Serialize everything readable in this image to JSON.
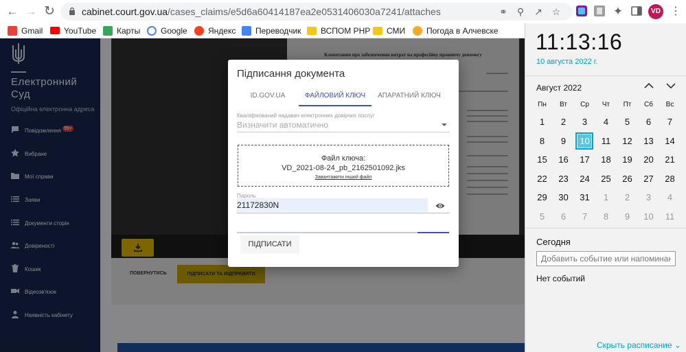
{
  "browser": {
    "url_host": "cabinet.court.gov.ua",
    "url_path": "/cases_claims/e5d6a60414187ea2e0531406030a7241/attaches",
    "profile_initials": "VD",
    "bookmarks": [
      {
        "label": "Gmail",
        "icon": "gmail-icon",
        "color": "#ea4335"
      },
      {
        "label": "YouTube",
        "icon": "youtube-icon",
        "color": "#ff0000"
      },
      {
        "label": "Карты",
        "icon": "maps-icon",
        "color": "#34a853"
      },
      {
        "label": "Google",
        "icon": "google-icon",
        "color": "#4285f4"
      },
      {
        "label": "Яндекс",
        "icon": "yandex-icon",
        "color": "#fc3f1d"
      },
      {
        "label": "Переводчик",
        "icon": "translate-icon",
        "color": "#4285f4"
      },
      {
        "label": "ВСПОМ РНР",
        "icon": "folder-icon",
        "color": "#f5c518"
      },
      {
        "label": "СМИ",
        "icon": "folder-icon",
        "color": "#f5c518"
      },
      {
        "label": "Погода в Алчевске",
        "icon": "weather-icon",
        "color": "#f9a825"
      }
    ]
  },
  "site": {
    "brand_line1": "Електронний",
    "brand_line2": "Суд",
    "brand_sub": "Офіційна електронна адреса",
    "menu": [
      {
        "label": "Повідомлення",
        "badge": "99+"
      },
      {
        "label": "Вибране"
      },
      {
        "label": "Мої справи"
      },
      {
        "label": "Заяви"
      },
      {
        "label": "Документи сторін"
      },
      {
        "label": "Довіреності"
      },
      {
        "label": "Кошик"
      },
      {
        "label": "Відеозв'язок"
      },
      {
        "label": "Наявність кабінету"
      }
    ],
    "doc_title": "Клопотання про забезпечення витрат на професійну правничу допомогу",
    "back_label": "ПОВЕРНУТИСЬ",
    "submit_send_label": "ПІДПИСАТИ ТА ВІДПРАВИТИ"
  },
  "dialog": {
    "title": "Підписання документа",
    "tabs": [
      "ID.GOV.UA",
      "ФАЙЛОВИЙ КЛЮЧ",
      "АПАРАТНИЙ КЛЮЧ"
    ],
    "active_tab": 1,
    "provider_label": "Кваліфікований надавач електронних довірчих послуг",
    "provider_value": "Визначити автоматично",
    "key_file_label": "Файл ключа:",
    "key_file_name": "VD_2021-08-24_pb_2162501092.jks",
    "upload_other": "Завантажити інший файл",
    "password_label": "Пароль",
    "password_value": "21172830N",
    "progress_fraction": 0.15,
    "sign_label": "ПІДПИСАТИ"
  },
  "clock": {
    "time": "11:13:16",
    "date": "10 августа 2022 г.",
    "month": "Август 2022",
    "dow": [
      "Пн",
      "Вт",
      "Ср",
      "Чт",
      "Пт",
      "Сб",
      "Вс"
    ],
    "weeks": [
      [
        [
          "1",
          0
        ],
        [
          "2",
          0
        ],
        [
          "3",
          0
        ],
        [
          "4",
          0
        ],
        [
          "5",
          0
        ],
        [
          "6",
          0
        ],
        [
          "7",
          0
        ]
      ],
      [
        [
          "8",
          0
        ],
        [
          "9",
          0
        ],
        [
          "10",
          2
        ],
        [
          "11",
          0
        ],
        [
          "12",
          0
        ],
        [
          "13",
          0
        ],
        [
          "14",
          0
        ]
      ],
      [
        [
          "15",
          0
        ],
        [
          "16",
          0
        ],
        [
          "17",
          0
        ],
        [
          "18",
          0
        ],
        [
          "19",
          0
        ],
        [
          "20",
          0
        ],
        [
          "21",
          0
        ]
      ],
      [
        [
          "22",
          0
        ],
        [
          "23",
          0
        ],
        [
          "24",
          0
        ],
        [
          "25",
          0
        ],
        [
          "26",
          0
        ],
        [
          "27",
          0
        ],
        [
          "28",
          0
        ]
      ],
      [
        [
          "29",
          0
        ],
        [
          "30",
          0
        ],
        [
          "31",
          0
        ],
        [
          "1",
          1
        ],
        [
          "2",
          1
        ],
        [
          "3",
          1
        ],
        [
          "4",
          1
        ]
      ],
      [
        [
          "5",
          1
        ],
        [
          "6",
          1
        ],
        [
          "7",
          1
        ],
        [
          "8",
          1
        ],
        [
          "9",
          1
        ],
        [
          "10",
          1
        ],
        [
          "11",
          1
        ]
      ]
    ],
    "today_label": "Сегодня",
    "event_placeholder": "Добавить событие или напоминание",
    "no_events": "Нет событий",
    "hide_label": "Скрыть расписание",
    "accent": "#00a2c7"
  }
}
